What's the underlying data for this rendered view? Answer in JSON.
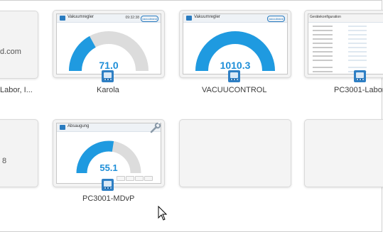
{
  "row1": {
    "partial_left": {
      "text_top": "d.com",
      "text_bottom": "Labor, I..."
    },
    "karola": {
      "label": "Karola",
      "screen_title": "Vakuumregler",
      "screen_time": "09:32:38",
      "screen_brand": "vacuubrand",
      "gauge_value": "71.0",
      "gauge_fill_fraction": 0.34,
      "gauge_color": "#1f9ae0",
      "icon": "controller-icon"
    },
    "vacuucontrol": {
      "label": "VACUUCONTROL",
      "screen_title": "Vakuumregler",
      "screen_brand": "vacuubrand",
      "gauge_value": "1010.3",
      "gauge_fill_fraction": 1.0,
      "gauge_color": "#1f9ae0",
      "icon": "controller-icon"
    },
    "pc3001_labor": {
      "label": "PC3001-Labor",
      "screen_title": "Gerätekonfiguration",
      "icon": "controller-icon"
    }
  },
  "row2": {
    "partial_left": {
      "text": "8"
    },
    "pc3001_mdvp": {
      "label": "PC3001-MDvP",
      "screen_title": "Absaugung",
      "gauge_value": "55.1",
      "gauge_fill_fraction": 0.55,
      "gauge_color": "#1f9ae0",
      "icon": "controller-icon",
      "tools_icon": "wrench-icon"
    }
  },
  "colors": {
    "accent": "#1f9ae0",
    "card_bg": "#f3f3f3",
    "icon_blue": "#2e7fc4"
  }
}
